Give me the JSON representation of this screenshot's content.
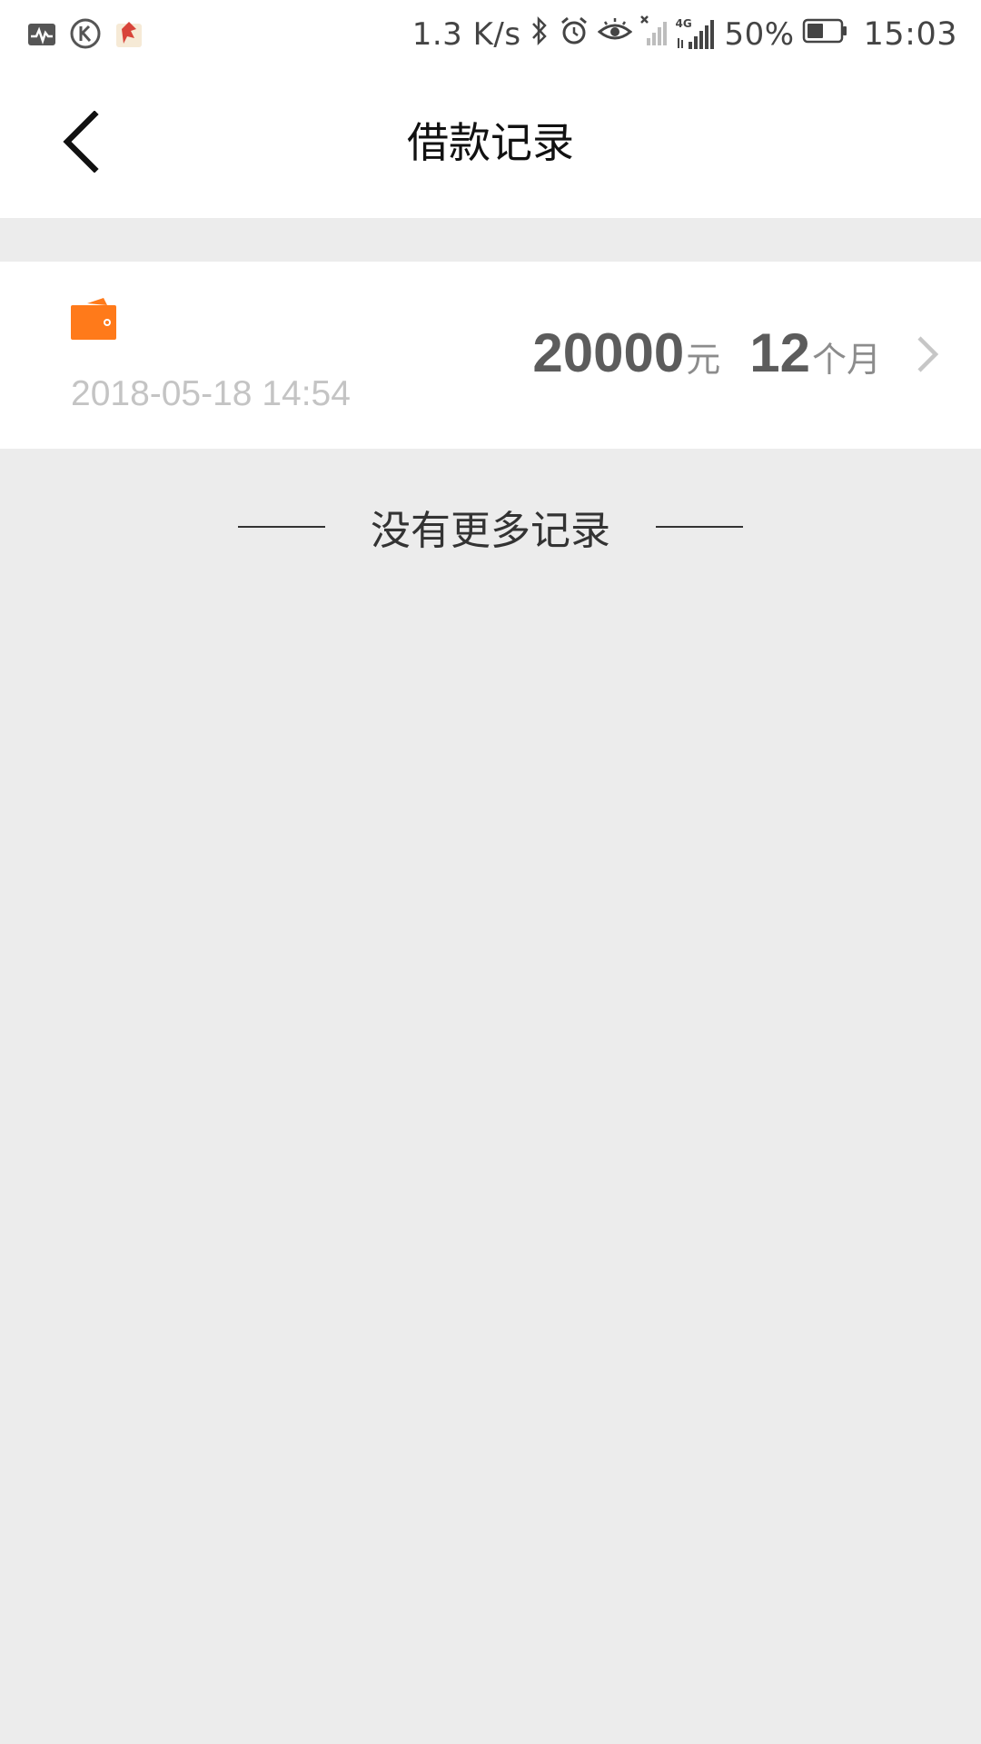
{
  "status_bar": {
    "net_speed": "1.3 K/s",
    "battery": "50%",
    "time": "15:03",
    "icons": [
      "activity-icon",
      "k-app-icon",
      "app-notification-icon",
      "bluetooth-icon",
      "alarm-icon",
      "eye-icon",
      "signal-no-sim-icon",
      "signal-4g-icon",
      "battery-icon"
    ],
    "network_label": "4G"
  },
  "nav": {
    "title": "借款记录",
    "back_icon": "chevron-left-icon"
  },
  "records": [
    {
      "icon": "wallet-icon",
      "date": "2018-05-18 14:54",
      "amount": "20000",
      "amount_unit": "元",
      "term": "12",
      "term_unit": "个月"
    }
  ],
  "footer": {
    "no_more_text": "没有更多记录"
  },
  "colors": {
    "accent": "#ff7a1a",
    "background": "#ececec",
    "card": "#ffffff",
    "date_text": "#c4c4c4",
    "amount_text": "#5c5c5c"
  }
}
